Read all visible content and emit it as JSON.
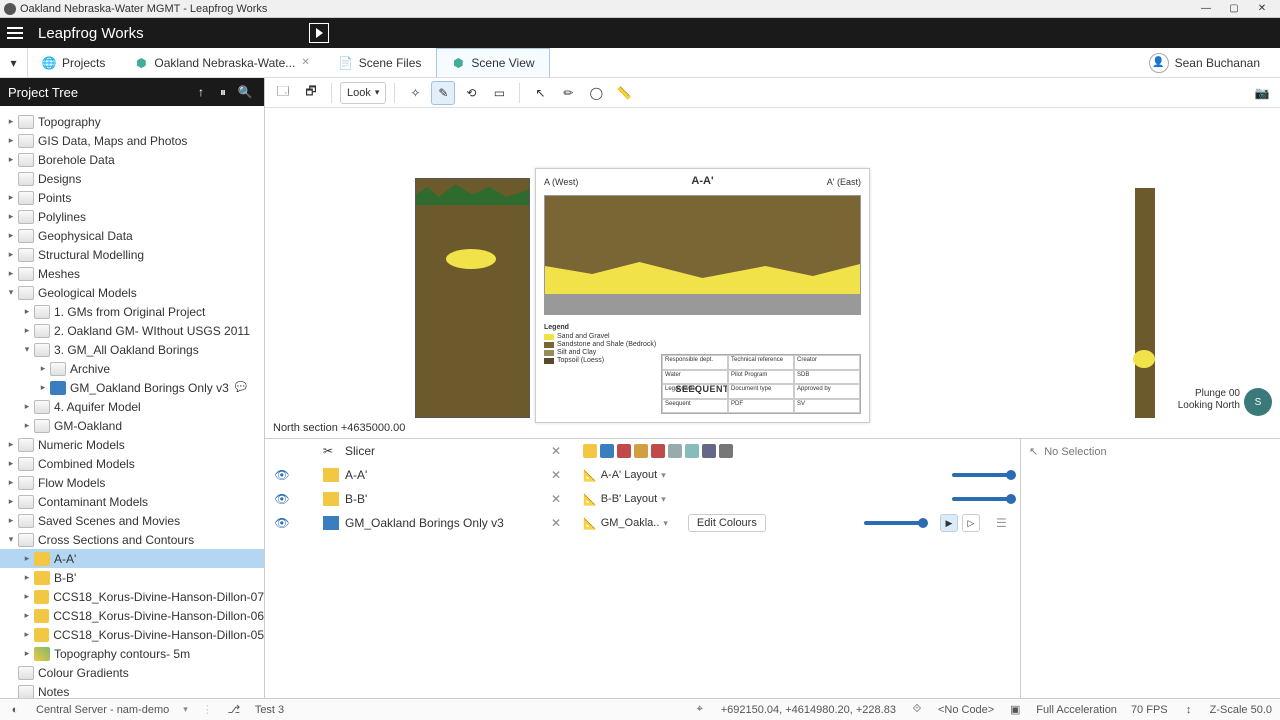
{
  "window": {
    "title": "Oakland Nebraska-Water MGMT - Leapfrog Works"
  },
  "brand": "Leapfrog Works",
  "tabs": {
    "items": [
      {
        "label": "Projects",
        "icon": "globe"
      },
      {
        "label": "Oakland Nebraska-Wate...",
        "icon": "cube",
        "closable": true
      },
      {
        "label": "Scene Files",
        "icon": "doc"
      },
      {
        "label": "Scene View",
        "icon": "cube",
        "active": true
      }
    ]
  },
  "user": {
    "name": "Sean Buchanan"
  },
  "tree": {
    "title": "Project Tree",
    "items": [
      {
        "d": 0,
        "a": "col",
        "i": "folder",
        "l": "Topography"
      },
      {
        "d": 0,
        "a": "col",
        "i": "folder",
        "l": "GIS Data, Maps and Photos"
      },
      {
        "d": 0,
        "a": "col",
        "i": "folder",
        "l": "Borehole Data"
      },
      {
        "d": 0,
        "a": "none",
        "i": "folder",
        "l": "Designs"
      },
      {
        "d": 0,
        "a": "col",
        "i": "folder",
        "l": "Points"
      },
      {
        "d": 0,
        "a": "col",
        "i": "folder",
        "l": "Polylines"
      },
      {
        "d": 0,
        "a": "col",
        "i": "folder",
        "l": "Geophysical Data"
      },
      {
        "d": 0,
        "a": "col",
        "i": "folder",
        "l": "Structural Modelling"
      },
      {
        "d": 0,
        "a": "col",
        "i": "folder",
        "l": "Meshes"
      },
      {
        "d": 0,
        "a": "exp",
        "i": "folder",
        "l": "Geological Models"
      },
      {
        "d": 1,
        "a": "col",
        "i": "folder",
        "l": "1. GMs from Original Project"
      },
      {
        "d": 1,
        "a": "col",
        "i": "folder",
        "l": "2. Oakland GM- WIthout USGS 2011"
      },
      {
        "d": 1,
        "a": "exp",
        "i": "folder",
        "l": "3. GM_All Oakland Borings"
      },
      {
        "d": 2,
        "a": "col",
        "i": "folder",
        "l": "Archive"
      },
      {
        "d": 2,
        "a": "col",
        "i": "cube",
        "l": "GM_Oakland Borings Only v3",
        "chat": true
      },
      {
        "d": 1,
        "a": "col",
        "i": "folder",
        "l": "4. Aquifer Model"
      },
      {
        "d": 1,
        "a": "col",
        "i": "folder",
        "l": "GM-Oakland"
      },
      {
        "d": 0,
        "a": "col",
        "i": "folder",
        "l": "Numeric Models"
      },
      {
        "d": 0,
        "a": "col",
        "i": "folder",
        "l": "Combined Models"
      },
      {
        "d": 0,
        "a": "col",
        "i": "folder",
        "l": "Flow Models"
      },
      {
        "d": 0,
        "a": "col",
        "i": "folder",
        "l": "Contaminant Models"
      },
      {
        "d": 0,
        "a": "col",
        "i": "folder",
        "l": "Saved Scenes and Movies"
      },
      {
        "d": 0,
        "a": "exp",
        "i": "folder",
        "l": "Cross Sections and Contours"
      },
      {
        "d": 1,
        "a": "col",
        "i": "yellow",
        "l": "A-A'",
        "selected": true
      },
      {
        "d": 1,
        "a": "col",
        "i": "yellow",
        "l": "B-B'"
      },
      {
        "d": 1,
        "a": "col",
        "i": "yellow",
        "l": "CCS18_Korus-Divine-Hanson-Dillon-07"
      },
      {
        "d": 1,
        "a": "col",
        "i": "yellow",
        "l": "CCS18_Korus-Divine-Hanson-Dillon-06"
      },
      {
        "d": 1,
        "a": "col",
        "i": "yellow",
        "l": "CCS18_Korus-Divine-Hanson-Dillon-05"
      },
      {
        "d": 1,
        "a": "col",
        "i": "contour",
        "l": "Topography contours- 5m"
      },
      {
        "d": 0,
        "a": "none",
        "i": "folder",
        "l": "Colour Gradients"
      },
      {
        "d": 0,
        "a": "none",
        "i": "folder",
        "l": "Notes"
      }
    ]
  },
  "toolbar": {
    "look": "Look"
  },
  "viewport": {
    "label": "North section +4635000.00",
    "plunge": "Plunge 00",
    "looking": "Looking North",
    "compass": "S"
  },
  "section_sheet": {
    "title": "A-A'",
    "left": "A (West)",
    "right": "A' (East)",
    "legend_header": "Legend",
    "legend": [
      {
        "c": "#f2e24a",
        "t": "Sand and Gravel"
      },
      {
        "c": "#7a6534",
        "t": "Sandstone and Shale (Bedrock)"
      },
      {
        "c": "#9a8a5a",
        "t": "Silt and Clay"
      },
      {
        "c": "#5a4a2a",
        "t": "Topsoil (Loess)"
      }
    ],
    "brand": "SEEQUENT",
    "titleblock": {
      "r0c0": "Responsible dept.",
      "r0c1": "Technical reference",
      "r0c2": "Creator",
      "r1c0": "Water",
      "r1c1": "Pilot Program",
      "r1c2": "SDB",
      "r2c0": "Legal owner",
      "r2c1": "Document type",
      "r2c2": "Approved by",
      "r3c0": "Seequent",
      "r3c1": "PDF",
      "r3c2": "SV"
    }
  },
  "scene_list": {
    "rows": [
      {
        "vis": false,
        "icon": "slicer",
        "label": "Slicer",
        "close": true,
        "mid": true
      },
      {
        "vis": true,
        "icon": "yellow",
        "label": "A-A'",
        "close": true,
        "layout": "A-A' Layout",
        "slider": true
      },
      {
        "vis": true,
        "icon": "yellow",
        "label": "B-B'",
        "close": true,
        "layout": "B-B' Layout",
        "slider": true
      },
      {
        "vis": true,
        "icon": "cube",
        "label": "GM_Oakland Borings Only v3",
        "close": true,
        "layout": "GM_Oakla..",
        "edit": "Edit Colours",
        "slider": true,
        "play": true
      }
    ],
    "no_selection": "No Selection"
  },
  "status": {
    "server": "Central Server - nam-demo",
    "branch": "Test 3",
    "coords": "+692150.04, +4614980.20, +228.83",
    "code": "<No Code>",
    "accel": "Full Acceleration",
    "fps": "70 FPS",
    "zscale": "Z-Scale 50.0"
  }
}
